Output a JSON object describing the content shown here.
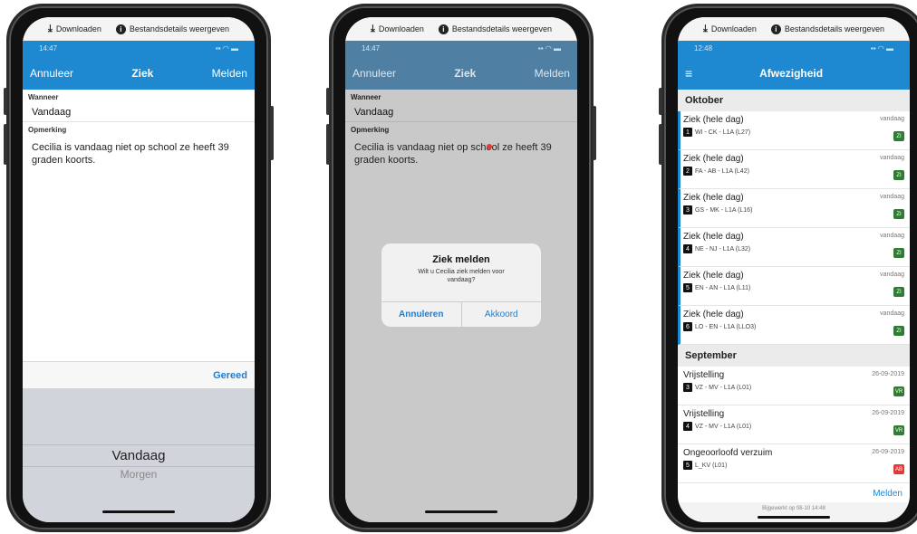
{
  "download_bar": {
    "download_label": "Downloaden",
    "details_label": "Bestandsdetails weergeven"
  },
  "status": {
    "time_1": "14:47",
    "time_2": "14:47",
    "time_3": "12:48"
  },
  "phone1": {
    "nav": {
      "cancel": "Annuleer",
      "title": "Ziek",
      "submit": "Melden"
    },
    "when_label": "Wanneer",
    "when_value": "Vandaag",
    "remark_label": "Opmerking",
    "remark_value": "Cecilia is vandaag niet op school ze heeft 39 graden koorts.",
    "done": "Gereed",
    "picker_selected": "Vandaag",
    "picker_next": "Morgen"
  },
  "phone2": {
    "nav": {
      "cancel": "Annuleer",
      "title": "Ziek",
      "submit": "Melden"
    },
    "when_label": "Wanneer",
    "when_value": "Vandaag",
    "remark_label": "Opmerking",
    "remark_value": "Cecilia is vandaag niet op school ze heeft 39 graden koorts.",
    "dialog": {
      "title": "Ziek melden",
      "message": "Wilt u Cecilia ziek melden voor vandaag?",
      "cancel": "Annuleren",
      "confirm": "Akkoord"
    }
  },
  "phone3": {
    "nav": {
      "title": "Afwezigheid"
    },
    "sections": [
      {
        "header": "Oktober",
        "items": [
          {
            "title": "Ziek (hele dag)",
            "num": "1",
            "sub": "WI - CK - L1A (L27)",
            "date": "vandaag",
            "badge": "ZI",
            "badge_color": "#2e7d32"
          },
          {
            "title": "Ziek (hele dag)",
            "num": "2",
            "sub": "FA - AB - L1A (L42)",
            "date": "vandaag",
            "badge": "ZI",
            "badge_color": "#2e7d32"
          },
          {
            "title": "Ziek (hele dag)",
            "num": "3",
            "sub": "GS - MK - L1A (L16)",
            "date": "vandaag",
            "badge": "ZI",
            "badge_color": "#2e7d32"
          },
          {
            "title": "Ziek (hele dag)",
            "num": "4",
            "sub": "NE - NJ - L1A (L32)",
            "date": "vandaag",
            "badge": "ZI",
            "badge_color": "#2e7d32"
          },
          {
            "title": "Ziek (hele dag)",
            "num": "5",
            "sub": "EN - AN - L1A (L11)",
            "date": "vandaag",
            "badge": "ZI",
            "badge_color": "#2e7d32"
          },
          {
            "title": "Ziek (hele dag)",
            "num": "6",
            "sub": "LO - EN - L1A (LLO3)",
            "date": "vandaag",
            "badge": "ZI",
            "badge_color": "#2e7d32"
          }
        ]
      },
      {
        "header": "September",
        "items": [
          {
            "title": "Vrijstelling",
            "num": "3",
            "sub": "VZ - MV - L1A (L01)",
            "date": "26-09-2019",
            "badge": "VR",
            "badge_color": "#2e7d32"
          },
          {
            "title": "Vrijstelling",
            "num": "4",
            "sub": "VZ - MV - L1A (L01)",
            "date": "26-09-2019",
            "badge": "VR",
            "badge_color": "#2e7d32"
          },
          {
            "title": "Ongeoorloofd verzuim",
            "num": "5",
            "sub": "L_KV (L01)",
            "date": "26-09-2019",
            "badge": "AB",
            "badge_color": "#e53935"
          }
        ]
      }
    ],
    "footer_link": "Melden",
    "footer_status": "Bijgewerkt op 08-10 14:48"
  },
  "colors": {
    "accent": "#1e88d0",
    "present_badge": "#2e7d32",
    "absent_badge": "#e53935"
  }
}
